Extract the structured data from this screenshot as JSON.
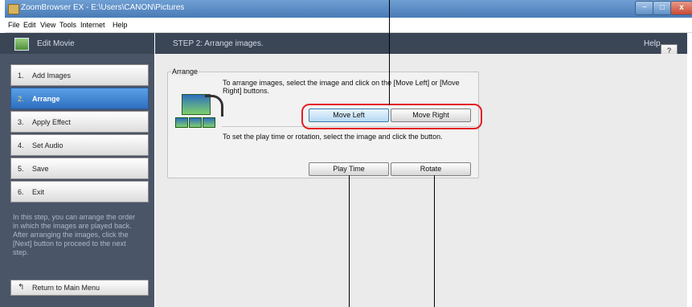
{
  "window": {
    "title": "ZoomBrowser EX  -  E:\\Users\\CANON\\Pictures",
    "buttons": {
      "minimize": "−",
      "maximize": "□",
      "close": "x"
    }
  },
  "menu": [
    "File",
    "Edit",
    "View",
    "Tools",
    "Internet",
    "Help"
  ],
  "left_panel": {
    "header": "Edit Movie",
    "steps": [
      {
        "num": "1.",
        "label": "Add Images",
        "active": false
      },
      {
        "num": "2.",
        "label": "Arrange",
        "active": true
      },
      {
        "num": "3.",
        "label": "Apply Effect",
        "active": false
      },
      {
        "num": "4.",
        "label": "Set Audio",
        "active": false
      },
      {
        "num": "5.",
        "label": "Save",
        "active": false
      },
      {
        "num": "6.",
        "label": "Exit",
        "active": false
      }
    ],
    "description": "In this step, you can arrange the order in which the images are played back.\nAfter arranging the images, click the [Next] button to proceed to the next step.",
    "return_button": "Return to Main Menu"
  },
  "main": {
    "step_title": "STEP 2: Arrange images.",
    "help_label": "Help",
    "help_button": "?",
    "group_label": "Arrange",
    "instruction1": "To arrange images, select the image and click on the [Move Left] or [Move Right] buttons.",
    "instruction2": "To set the play time or rotation, select the image and click the button.",
    "buttons": {
      "move_left": "Move Left",
      "move_right": "Move Right",
      "play_time": "Play Time",
      "rotate": "Rotate"
    }
  },
  "colors": {
    "titlebar": "#4a7bb6",
    "left_panel": "#4b5568",
    "active_step": "#2f6fc0",
    "highlight": "#e41e26"
  }
}
